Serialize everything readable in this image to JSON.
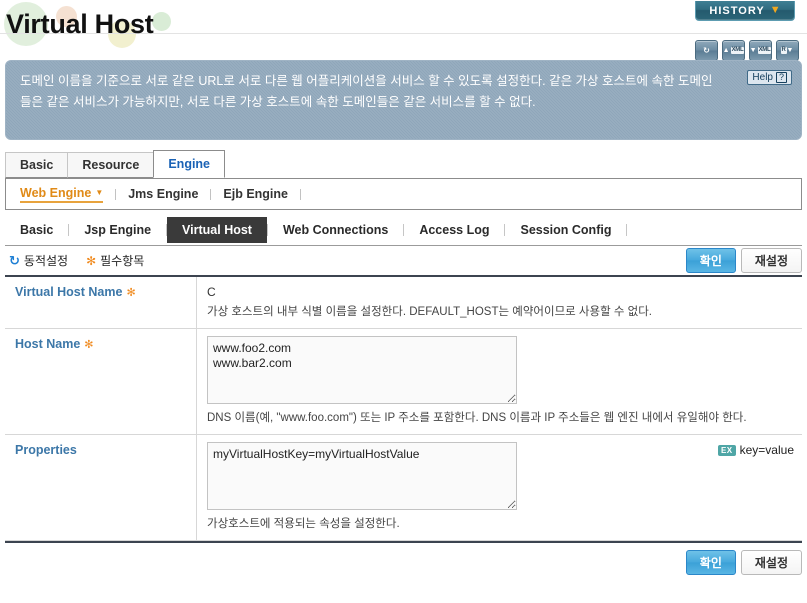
{
  "header": {
    "title": "Virtual Host",
    "history_label": "HISTORY",
    "history_chevron": "chevron-down-icon",
    "icons": [
      {
        "name": "refresh-icon",
        "glyph": "↻"
      },
      {
        "name": "xml-upload-icon",
        "label": "XML",
        "arrow": "▲"
      },
      {
        "name": "xml-download-icon",
        "label": "XML",
        "arrow": "▼"
      },
      {
        "name": "export-report-icon",
        "label": "R",
        "arrow": "▼"
      }
    ]
  },
  "description": {
    "text": "도메인 이름을 기준으로 서로 같은 URL로 서로 다른 웹 어플리케이션을 서비스 할 수 있도록 설정한다. 같은 가상 호스트에 속한 도메인들은 같은 서비스가 가능하지만, 서로 다른 가상 호스트에 속한 도메인들은 같은 서비스를 할 수 없다.",
    "help_label": "Help",
    "help_mark": "?"
  },
  "tabs_primary": [
    {
      "label": "Basic",
      "active": false
    },
    {
      "label": "Resource",
      "active": false
    },
    {
      "label": "Engine",
      "active": true
    }
  ],
  "engines": [
    {
      "label": "Web Engine",
      "active": true
    },
    {
      "label": "Jms Engine",
      "active": false
    },
    {
      "label": "Ejb Engine",
      "active": false
    }
  ],
  "tabs_secondary": [
    {
      "label": "Basic",
      "active": false
    },
    {
      "label": "Jsp Engine",
      "active": false
    },
    {
      "label": "Virtual Host",
      "active": true
    },
    {
      "label": "Web Connections",
      "active": false
    },
    {
      "label": "Access Log",
      "active": false
    },
    {
      "label": "Session Config",
      "active": false
    }
  ],
  "legend": {
    "dynamic_label": "동적설정",
    "required_label": "필수항목",
    "dynamic_icon": "refresh-icon",
    "required_icon": "asterisk-icon"
  },
  "actions": {
    "confirm_label": "확인",
    "reset_label": "재설정"
  },
  "form": {
    "rows": [
      {
        "label": "Virtual Host Name",
        "required": true,
        "required_mark": "✻",
        "type": "text",
        "value": "C",
        "hint": "가상 호스트의 내부 식별 이름을 설정한다. DEFAULT_HOST는 예약어이므로 사용할 수 없다."
      },
      {
        "label": "Host Name",
        "required": true,
        "required_mark": "✻",
        "type": "textarea",
        "value": "www.foo2.com\nwww.bar2.com",
        "hint": "DNS 이름(예, \"www.foo.com\") 또는 IP 주소를 포함한다. DNS 이름과 IP 주소들은 웹 엔진 내에서 유일해야 한다."
      },
      {
        "label": "Properties",
        "required": false,
        "required_mark": "",
        "type": "textarea",
        "value": "myVirtualHostKey=myVirtualHostValue",
        "hint": "가상호스트에 적용되는 속성을 설정한다.",
        "example_badge": "EX",
        "example_text": "key=value"
      }
    ]
  }
}
